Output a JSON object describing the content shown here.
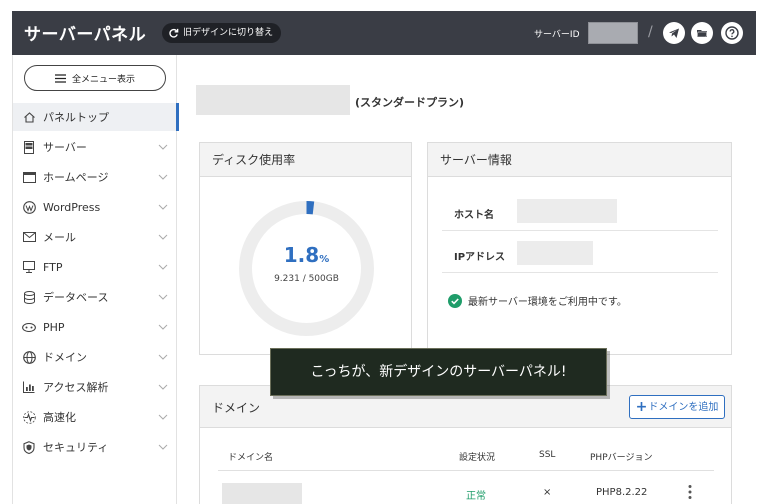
{
  "header": {
    "title": "サーバーパネル",
    "switch_label": "旧デザインに切り替え",
    "server_id_label": "サーバーID",
    "separator": "/",
    "icons": [
      "telegram-icon",
      "folder-icon",
      "help-icon"
    ]
  },
  "sidebar": {
    "all_menu_label": "全メニュー表示",
    "items": [
      {
        "label": "パネルトップ",
        "icon": "home-icon",
        "active": true
      },
      {
        "label": "サーバー",
        "icon": "server-icon"
      },
      {
        "label": "ホームページ",
        "icon": "browser-icon"
      },
      {
        "label": "WordPress",
        "icon": "wordpress-icon"
      },
      {
        "label": "メール",
        "icon": "mail-icon"
      },
      {
        "label": "FTP",
        "icon": "monitor-icon"
      },
      {
        "label": "データベース",
        "icon": "database-icon"
      },
      {
        "label": "PHP",
        "icon": "php-icon"
      },
      {
        "label": "ドメイン",
        "icon": "globe-icon"
      },
      {
        "label": "アクセス解析",
        "icon": "chart-icon"
      },
      {
        "label": "高速化",
        "icon": "speed-icon"
      },
      {
        "label": "セキュリティ",
        "icon": "shield-icon"
      }
    ]
  },
  "main": {
    "plan_label": "(スタンダードプラン)",
    "disk": {
      "title": "ディスク使用率",
      "percent": "1.8",
      "percent_unit": "%",
      "usage_fraction": 0.018,
      "usage_text": "9.231 / 500GB"
    },
    "server_info": {
      "title": "サーバー情報",
      "host_label": "ホスト名",
      "ip_label": "IPアドレス",
      "status_text": "最新サーバー環境をご利用中です。"
    },
    "tooltip": "こっちが、新デザインのサーバーパネル!",
    "domain": {
      "title": "ドメイン",
      "add_button": "ドメインを追加",
      "columns": [
        "ドメイン名",
        "設定状況",
        "SSL",
        "PHPバージョン"
      ],
      "rows": [
        {
          "status": "正常",
          "ssl": "×",
          "php": "PHP8.2.22"
        }
      ]
    }
  },
  "colors": {
    "header_bg": "#3a3d45",
    "accent": "#2f6fc0",
    "ok_green": "#1f9d6a",
    "tooltip_bg": "#1f2a20"
  }
}
